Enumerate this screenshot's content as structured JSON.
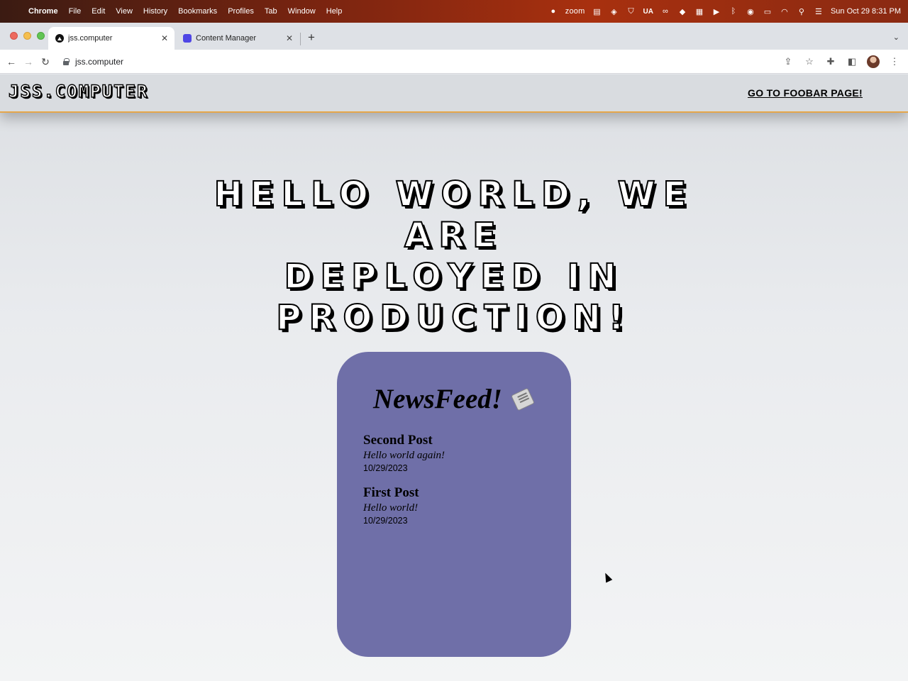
{
  "menubar": {
    "app": "Chrome",
    "items": [
      "File",
      "Edit",
      "View",
      "History",
      "Bookmarks",
      "Profiles",
      "Tab",
      "Window",
      "Help"
    ],
    "zoom_label": "zoom",
    "ua_label": "UA",
    "clock": "Sun Oct 29  8:31 PM"
  },
  "browser": {
    "tabs": [
      {
        "title": "jss.computer",
        "active": true
      },
      {
        "title": "Content Manager",
        "active": false
      }
    ],
    "url": "jss.computer"
  },
  "site": {
    "brand": "JSS.COMPUTER",
    "nav_link": "GO TO FOOBAR PAGE!",
    "hero_lines": [
      "HELLO WORLD, WE ARE",
      "DEPLOYED IN",
      "PRODUCTION!"
    ],
    "feed": {
      "title": "NewsFeed!",
      "icon": "newspaper-icon",
      "card_color": "#6f6fa8",
      "posts": [
        {
          "title": "Second Post",
          "body": "Hello world again!",
          "date": "10/29/2023"
        },
        {
          "title": "First Post",
          "body": "Hello world!",
          "date": "10/29/2023"
        }
      ]
    }
  },
  "colors": {
    "header_accent": "#e5a64a",
    "menubar_accent": "#a8300f"
  }
}
